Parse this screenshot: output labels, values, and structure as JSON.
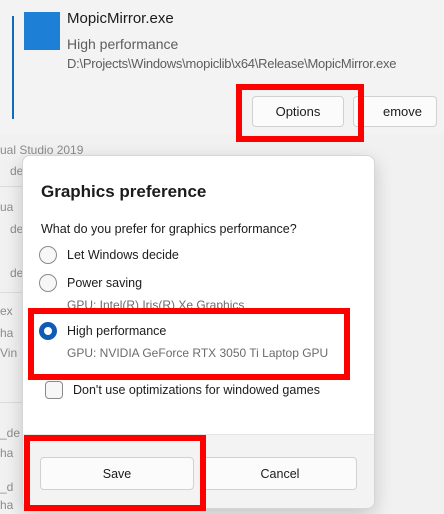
{
  "app_card": {
    "name": "MopicMirror.exe",
    "mode": "High performance",
    "path": "D:\\Projects\\Windows\\mopiclib\\x64\\Release\\MopicMirror.exe",
    "options_label": "Options",
    "remove_label": "emove"
  },
  "background_list": {
    "fragments": [
      "ual Studio 2019",
      "de",
      "ua",
      "de",
      "de",
      "ex",
      "ha",
      "Vin",
      "_de",
      "ha",
      "_d",
      "ha"
    ]
  },
  "dialog": {
    "title": "Graphics preference",
    "question": "What do you prefer for graphics performance?",
    "options": [
      {
        "label": "Let Windows decide",
        "gpu": "",
        "selected": false
      },
      {
        "label": "Power saving",
        "gpu": "GPU: Intel(R) Iris(R) Xe Graphics",
        "selected": false
      },
      {
        "label": "High performance",
        "gpu": "GPU: NVIDIA GeForce RTX 3050 Ti Laptop GPU",
        "selected": true
      }
    ],
    "checkbox_label": "Don't use optimizations for windowed games",
    "checkbox_checked": false,
    "save_label": "Save",
    "cancel_label": "Cancel"
  },
  "colors": {
    "highlight": "#ff0000",
    "accent": "#0f5bb6",
    "app_tile": "#1e7fd6"
  }
}
